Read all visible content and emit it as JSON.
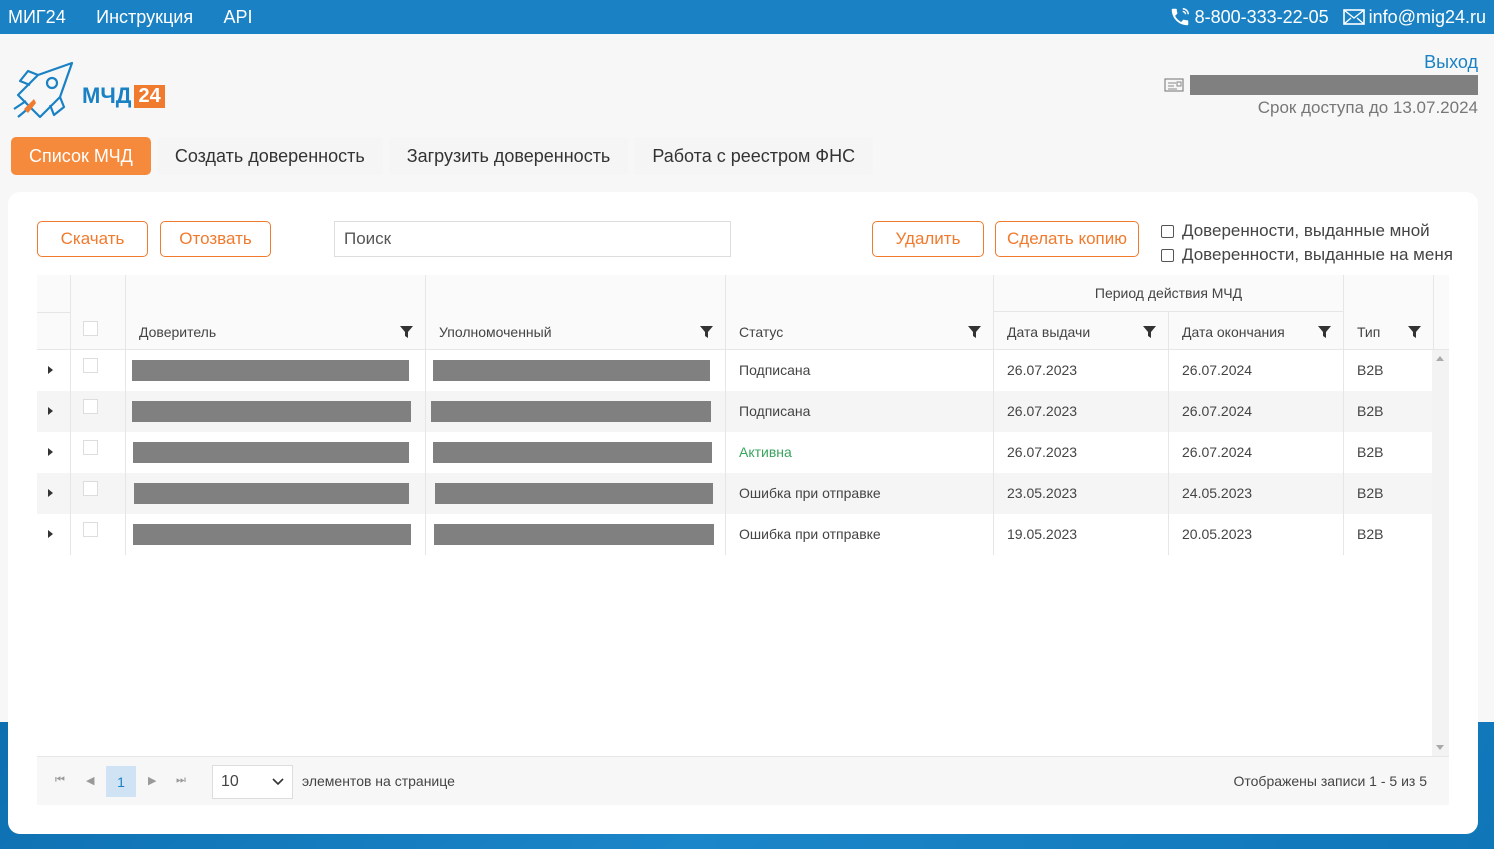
{
  "topbar": {
    "nav": [
      "МИГ24",
      "Инструкция",
      "API"
    ],
    "phone": "8-800-333-22-05",
    "email": "info@mig24.ru"
  },
  "logo": {
    "text": "МЧД",
    "number": "24"
  },
  "user": {
    "logout": "Выход",
    "access": "Срок доступа до 13.07.2024"
  },
  "tabs": [
    "Список МЧД",
    "Создать доверенность",
    "Загрузить доверенность",
    "Работа с реестром ФНС"
  ],
  "toolbar": {
    "download": "Скачать",
    "revoke": "Отозвать",
    "search_placeholder": "Поиск",
    "delete": "Удалить",
    "copy": "Сделать копию",
    "filter_issued_by_me": "Доверенности, выданные мной",
    "filter_issued_to_me": "Доверенности, выданные на меня"
  },
  "grid": {
    "group_header": "Период действия МЧД",
    "columns": {
      "principal": "Доверитель",
      "representative": "Уполномоченный",
      "status": "Статус",
      "issue_date": "Дата выдачи",
      "end_date": "Дата окончания",
      "type": "Тип"
    },
    "rows": [
      {
        "status": "Подписана",
        "issue_date": "26.07.2023",
        "end_date": "26.07.2024",
        "type": "B2B"
      },
      {
        "status": "Подписана",
        "issue_date": "26.07.2023",
        "end_date": "26.07.2024",
        "type": "B2B"
      },
      {
        "status": "Активна",
        "issue_date": "26.07.2023",
        "end_date": "26.07.2024",
        "type": "B2B"
      },
      {
        "status": "Ошибка при отправке",
        "issue_date": "23.05.2023",
        "end_date": "24.05.2023",
        "type": "B2B"
      },
      {
        "status": "Ошибка при отправке",
        "issue_date": "19.05.2023",
        "end_date": "20.05.2023",
        "type": "B2B"
      }
    ]
  },
  "pager": {
    "current_page": "1",
    "page_size": "10",
    "page_size_label": "элементов на странице",
    "info": "Отображены записи 1 - 5 из 5"
  },
  "colors": {
    "brand_blue": "#1a82c4",
    "accent_orange": "#f07a2d",
    "active_green": "#3aa35e"
  }
}
